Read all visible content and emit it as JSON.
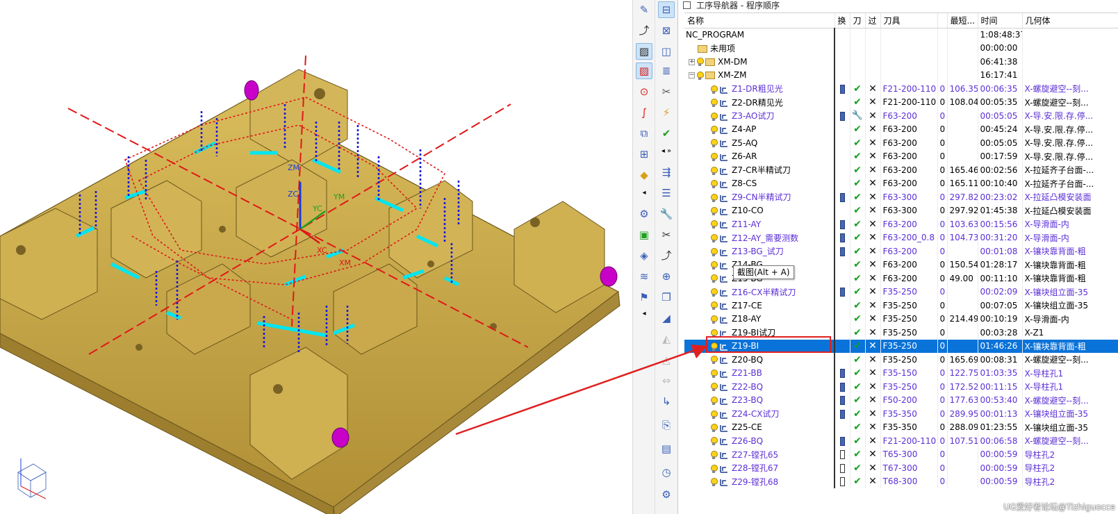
{
  "navigator": {
    "title": "工序导航器 - 程序顺序",
    "columns": [
      "名称",
      "换",
      "刀",
      "过",
      "刀具",
      "",
      "最短...",
      "时间",
      "几何体"
    ],
    "rows": [
      {
        "name": "NC_PROGRAM",
        "level": 0,
        "kind": "root",
        "chg": "",
        "tool_ok": false,
        "cut": false,
        "tool": "",
        "num": "",
        "len": "",
        "time": "1:08:48:37",
        "geom": "",
        "purple": false
      },
      {
        "name": "未用项",
        "level": 1,
        "kind": "folder",
        "chg": "",
        "tool_ok": false,
        "cut": false,
        "tool": "",
        "num": "",
        "len": "",
        "time": "00:00:00",
        "geom": "",
        "purple": false
      },
      {
        "name": "XM-DM",
        "level": 1,
        "kind": "group",
        "exp": "+",
        "chg": "",
        "tool_ok": false,
        "cut": false,
        "tool": "",
        "num": "",
        "len": "",
        "time": "06:41:38",
        "geom": "",
        "purple": false
      },
      {
        "name": "XM-ZM",
        "level": 1,
        "kind": "group",
        "exp": "−",
        "chg": "",
        "tool_ok": false,
        "cut": false,
        "tool": "",
        "num": "",
        "len": "",
        "time": "16:17:41",
        "geom": "",
        "purple": false
      },
      {
        "name": "Z1-DR粗见光",
        "level": 2,
        "kind": "op",
        "chg": "b",
        "tool_ok": true,
        "cut": true,
        "tool": "F21-200-110",
        "num": "0",
        "len": "106.35",
        "time": "00:06:35",
        "geom": "X-螺旋避空--刻...",
        "purple": true
      },
      {
        "name": "Z2-DR精见光",
        "level": 2,
        "kind": "op",
        "chg": "",
        "tool_ok": true,
        "cut": true,
        "tool": "F21-200-110",
        "num": "0",
        "len": "108.04",
        "time": "00:05:35",
        "geom": "X-螺旋避空--刻...",
        "purple": false
      },
      {
        "name": "Z3-AO试刀",
        "level": 2,
        "kind": "op",
        "chg": "b",
        "tool_ok": "wrench",
        "cut": true,
        "tool": "F63-200",
        "num": "0",
        "len": "",
        "time": "00:05:05",
        "geom": "X-导.安.限.存.停...",
        "purple": true
      },
      {
        "name": "Z4-AP",
        "level": 2,
        "kind": "op",
        "chg": "",
        "tool_ok": true,
        "cut": true,
        "tool": "F63-200",
        "num": "0",
        "len": "",
        "time": "00:45:24",
        "geom": "X-导.安.限.存.停...",
        "purple": false
      },
      {
        "name": "Z5-AQ",
        "level": 2,
        "kind": "op",
        "chg": "",
        "tool_ok": true,
        "cut": true,
        "tool": "F63-200",
        "num": "0",
        "len": "",
        "time": "00:05:05",
        "geom": "X-导.安.限.存.停...",
        "purple": false
      },
      {
        "name": "Z6-AR",
        "level": 2,
        "kind": "op",
        "chg": "",
        "tool_ok": true,
        "cut": true,
        "tool": "F63-200",
        "num": "0",
        "len": "",
        "time": "00:17:59",
        "geom": "X-导.安.限.存.停...",
        "purple": false
      },
      {
        "name": "Z7-CR半精试刀",
        "level": 2,
        "kind": "op",
        "chg": "",
        "tool_ok": true,
        "cut": true,
        "tool": "F63-200",
        "num": "0",
        "len": "165.46",
        "time": "00:02:56",
        "geom": "X-拉延齐子台面-...",
        "purple": false
      },
      {
        "name": "Z8-CS",
        "level": 2,
        "kind": "op",
        "chg": "",
        "tool_ok": true,
        "cut": true,
        "tool": "F63-200",
        "num": "0",
        "len": "165.11",
        "time": "00:10:40",
        "geom": "X-拉延齐子台面-...",
        "purple": false
      },
      {
        "name": "Z9-CN半精试刀",
        "level": 2,
        "kind": "op",
        "chg": "b",
        "tool_ok": true,
        "cut": true,
        "tool": "F63-300",
        "num": "0",
        "len": "297.82",
        "time": "00:23:02",
        "geom": "X-拉延凸模安装面",
        "purple": true
      },
      {
        "name": "Z10-CO",
        "level": 2,
        "kind": "op",
        "chg": "",
        "tool_ok": true,
        "cut": true,
        "tool": "F63-300",
        "num": "0",
        "len": "297.92",
        "time": "01:45:38",
        "geom": "X-拉延凸模安装面",
        "purple": false
      },
      {
        "name": "Z11-AY",
        "level": 2,
        "kind": "op",
        "chg": "b",
        "tool_ok": true,
        "cut": true,
        "tool": "F63-200",
        "num": "0",
        "len": "103.63",
        "time": "00:15:56",
        "geom": "X-导滑面-内",
        "purple": true
      },
      {
        "name": "Z12-AY_需要测数",
        "level": 2,
        "kind": "op",
        "chg": "b",
        "tool_ok": true,
        "cut": true,
        "tool": "F63-200_0.8",
        "num": "0",
        "len": "104.73",
        "time": "00:31:20",
        "geom": "X-导滑面-内",
        "purple": true
      },
      {
        "name": "Z13-BG_试刀",
        "level": 2,
        "kind": "op",
        "chg": "b",
        "tool_ok": true,
        "cut": true,
        "tool": "F63-200",
        "num": "0",
        "len": "",
        "time": "00:01:08",
        "geom": "X-镶块靠背面-粗",
        "purple": true
      },
      {
        "name": "Z14-BG",
        "level": 2,
        "kind": "op",
        "chg": "",
        "tool_ok": true,
        "cut": true,
        "tool": "F63-200",
        "num": "0",
        "len": "150.54",
        "time": "01:28:17",
        "geom": "X-镶块靠背面-粗",
        "purple": false
      },
      {
        "name": "Z15-BG",
        "level": 2,
        "kind": "op",
        "chg": "",
        "tool_ok": true,
        "cut": true,
        "tool": "F63-200",
        "num": "0",
        "len": "49.00",
        "time": "00:11:10",
        "geom": "X-镶块靠背面-粗",
        "purple": false
      },
      {
        "name": "Z16-CX半精试刀",
        "level": 2,
        "kind": "op",
        "chg": "b",
        "tool_ok": true,
        "cut": true,
        "tool": "F35-250",
        "num": "0",
        "len": "",
        "time": "00:02:09",
        "geom": "X-镶块组立面-35",
        "purple": true
      },
      {
        "name": "Z17-CE",
        "level": 2,
        "kind": "op",
        "chg": "",
        "tool_ok": true,
        "cut": true,
        "tool": "F35-250",
        "num": "0",
        "len": "",
        "time": "00:07:05",
        "geom": "X-镶块组立面-35",
        "purple": false
      },
      {
        "name": "Z18-AY",
        "level": 2,
        "kind": "op",
        "chg": "",
        "tool_ok": true,
        "cut": true,
        "tool": "F35-250",
        "num": "0",
        "len": "214.49",
        "time": "00:10:19",
        "geom": "X-导滑面-内",
        "purple": false
      },
      {
        "name": "Z19-BI试刀",
        "level": 2,
        "kind": "op",
        "chg": "",
        "tool_ok": true,
        "cut": true,
        "tool": "F35-250",
        "num": "0",
        "len": "",
        "time": "00:03:28",
        "geom": "X-Z1",
        "purple": false
      },
      {
        "name": "Z19-BI",
        "level": 2,
        "kind": "op",
        "chg": "",
        "tool_ok": true,
        "cut": true,
        "tool": "F35-250",
        "num": "0",
        "len": "",
        "time": "01:46:26",
        "geom": "X-镶块靠背面-粗",
        "purple": false,
        "selected": true
      },
      {
        "name": "Z20-BQ",
        "level": 2,
        "kind": "op",
        "chg": "",
        "tool_ok": true,
        "cut": true,
        "tool": "F35-250",
        "num": "0",
        "len": "165.69",
        "time": "00:08:31",
        "geom": "X-螺旋避空--刻...",
        "purple": false
      },
      {
        "name": "Z21-BB",
        "level": 2,
        "kind": "op",
        "chg": "b",
        "tool_ok": true,
        "cut": true,
        "tool": "F35-150",
        "num": "0",
        "len": "122.75",
        "time": "01:03:35",
        "geom": "X-导柱孔1",
        "purple": true
      },
      {
        "name": "Z22-BQ",
        "level": 2,
        "kind": "op",
        "chg": "b",
        "tool_ok": true,
        "cut": true,
        "tool": "F35-250",
        "num": "0",
        "len": "172.52",
        "time": "00:11:15",
        "geom": "X-导柱孔1",
        "purple": true
      },
      {
        "name": "Z23-BQ",
        "level": 2,
        "kind": "op",
        "chg": "b",
        "tool_ok": true,
        "cut": true,
        "tool": "F50-200",
        "num": "0",
        "len": "177.63",
        "time": "00:53:40",
        "geom": "X-螺旋避空--刻...",
        "purple": true
      },
      {
        "name": "Z24-CX试刀",
        "level": 2,
        "kind": "op",
        "chg": "b",
        "tool_ok": true,
        "cut": true,
        "tool": "F35-350",
        "num": "0",
        "len": "289.95",
        "time": "00:01:13",
        "geom": "X-镶块组立面-35",
        "purple": true
      },
      {
        "name": "Z25-CE",
        "level": 2,
        "kind": "op",
        "chg": "",
        "tool_ok": true,
        "cut": true,
        "tool": "F35-350",
        "num": "0",
        "len": "288.09",
        "time": "01:23:55",
        "geom": "X-镶块组立面-35",
        "purple": false
      },
      {
        "name": "Z26-BQ",
        "level": 2,
        "kind": "op",
        "chg": "b",
        "tool_ok": true,
        "cut": true,
        "tool": "F21-200-110",
        "num": "0",
        "len": "107.51",
        "time": "00:06:58",
        "geom": "X-螺旋避空--刻...",
        "purple": true
      },
      {
        "name": "Z27-镗孔65",
        "level": 2,
        "kind": "op",
        "chg": "w",
        "tool_ok": true,
        "cut": true,
        "tool": "T65-300",
        "num": "0",
        "len": "",
        "time": "00:00:59",
        "geom": "导柱孔2",
        "purple": true
      },
      {
        "name": "Z28-镗孔67",
        "level": 2,
        "kind": "op",
        "chg": "w",
        "tool_ok": true,
        "cut": true,
        "tool": "T67-300",
        "num": "0",
        "len": "",
        "time": "00:00:59",
        "geom": "导柱孔2",
        "purple": true
      },
      {
        "name": "Z29-镗孔68",
        "level": 2,
        "kind": "op",
        "chg": "w",
        "tool_ok": true,
        "cut": true,
        "tool": "T68-300",
        "num": "0",
        "len": "",
        "time": "00:00:59",
        "geom": "导柱孔2",
        "purple": true
      }
    ]
  },
  "tooltip": "截图(Alt + A)",
  "viewport": {
    "axis_labels": {
      "zm": "ZM",
      "zc": "ZC",
      "yc": "YC",
      "ym": "YM",
      "xc": "XC",
      "xm": "XM"
    }
  },
  "watermark": "UG爱好者论坛@Tizhiguocce",
  "colors": {
    "selection": "#0a73d9",
    "purple_text": "#5b2ed6",
    "part": "#c9a84a",
    "path_red": "#e01818",
    "path_blue": "#1a1ad8",
    "cyan": "#00e6f0",
    "highlight_box": "#e02020"
  }
}
